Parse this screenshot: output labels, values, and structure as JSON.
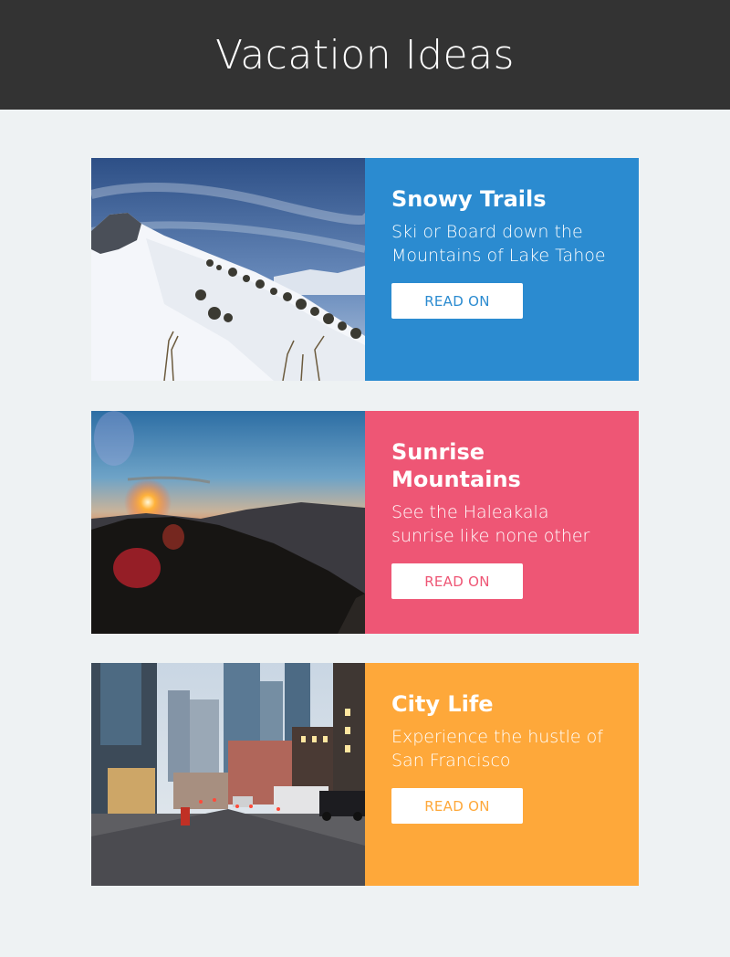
{
  "page": {
    "title": "Vacation Ideas"
  },
  "cards": [
    {
      "title": "Snowy Trails",
      "description": "Ski or Board down the Mountains of Lake Tahoe",
      "button_label": "READ ON",
      "color": "#2b8bd0"
    },
    {
      "title": "Sunrise Mountains",
      "description": "See the Haleakala sunrise like none other",
      "button_label": "READ ON",
      "color": "#ee5675"
    },
    {
      "title": "City Life",
      "description": "Experience the hustle of San Francisco",
      "button_label": "READ ON",
      "color": "#fea83a"
    }
  ]
}
